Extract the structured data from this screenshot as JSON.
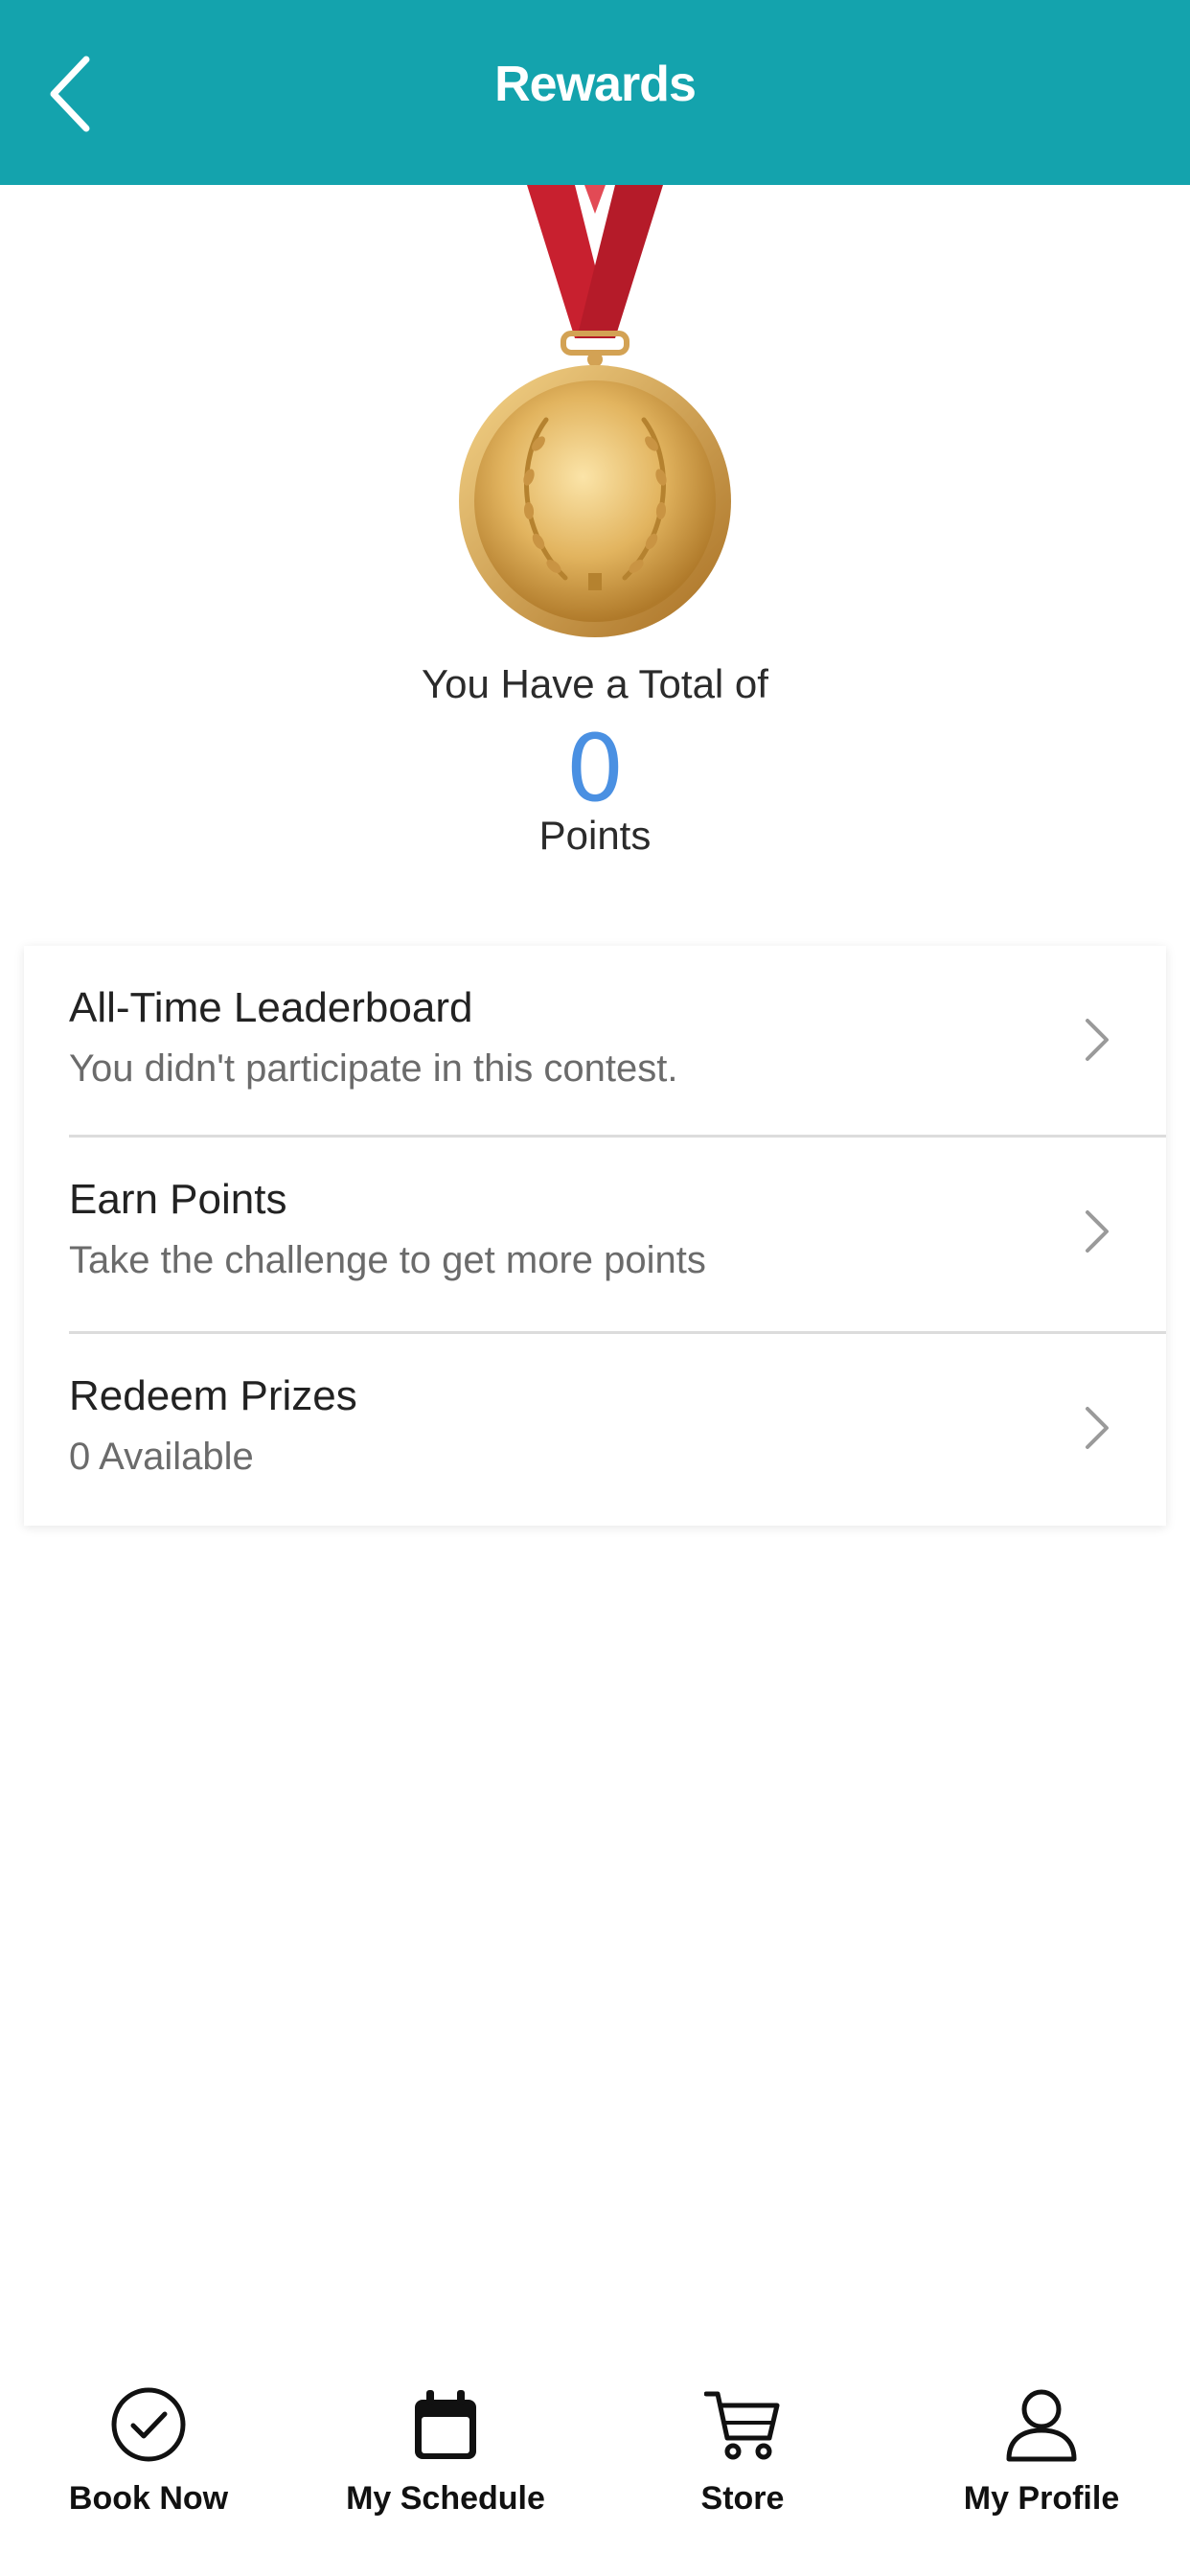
{
  "header": {
    "title": "Rewards",
    "back_icon": "chevron-left-icon",
    "background_color": "#14a3ad"
  },
  "summary": {
    "medal_icon": "gold-medal-icon",
    "total_label": "You Have a Total of",
    "points_value": "0",
    "points_unit": "Points",
    "points_color": "#4a90e2"
  },
  "menu": {
    "items": [
      {
        "title": "All-Time Leaderboard",
        "subtitle": "You didn't participate in this contest.",
        "icon": "chevron-right-icon"
      },
      {
        "title": "Earn Points",
        "subtitle": "Take the challenge to get more points",
        "icon": "chevron-right-icon"
      },
      {
        "title": "Redeem Prizes",
        "subtitle": "0 Available",
        "icon": "chevron-right-icon"
      }
    ]
  },
  "tabbar": {
    "tabs": [
      {
        "label": "Book Now",
        "icon": "check-circle-icon"
      },
      {
        "label": "My Schedule",
        "icon": "calendar-icon"
      },
      {
        "label": "Store",
        "icon": "cart-icon"
      },
      {
        "label": "My Profile",
        "icon": "person-icon"
      }
    ]
  }
}
